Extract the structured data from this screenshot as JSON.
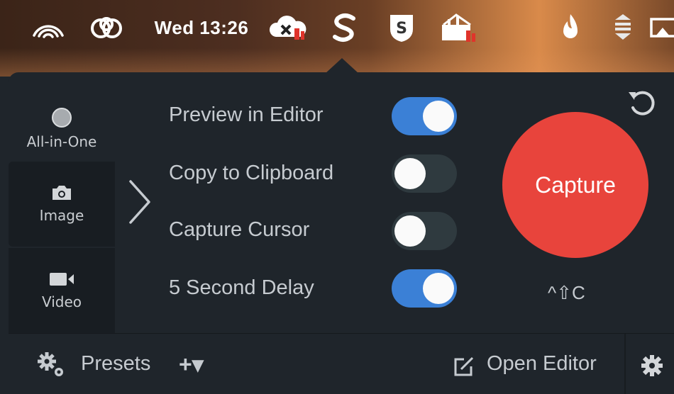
{
  "menubar": {
    "clock": "Wed 13:26",
    "icons": [
      "wifi-icon",
      "creative-cloud-icon",
      "cloud-alert-icon",
      "snagit-s-icon",
      "shield-s-icon",
      "toolbox-icon",
      "flame-icon",
      "stack-icon",
      "screen-mirror-icon"
    ]
  },
  "modes": [
    {
      "label": "All-in-One",
      "icon": "record-dot-icon"
    },
    {
      "label": "Image",
      "icon": "camera-icon"
    },
    {
      "label": "Video",
      "icon": "video-camera-icon"
    }
  ],
  "options": [
    {
      "label": "Preview in Editor",
      "on": true
    },
    {
      "label": "Copy to Clipboard",
      "on": false
    },
    {
      "label": "Capture Cursor",
      "on": false
    },
    {
      "label": "5 Second Delay",
      "on": true
    }
  ],
  "capture": {
    "label": "Capture",
    "shortcut": "^⇧C"
  },
  "bottom": {
    "presets_label": "Presets",
    "add_label": "+▾",
    "open_editor_label": "Open Editor"
  },
  "colors": {
    "accent_toggle": "#3b80d6",
    "capture_red": "#e8443c",
    "panel": "#1f252b"
  }
}
